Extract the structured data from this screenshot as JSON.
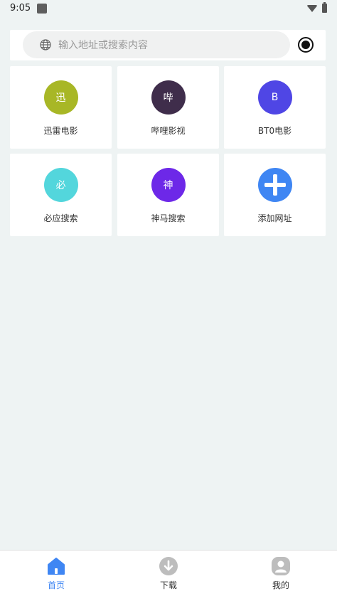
{
  "status": {
    "time": "9:05"
  },
  "search": {
    "placeholder": "输入地址或搜索内容"
  },
  "tiles": [
    {
      "glyph": "迅",
      "label": "迅雷电影",
      "color": "#a8b726"
    },
    {
      "glyph": "哔",
      "label": "哔哩影视",
      "color": "#3f2d4b"
    },
    {
      "glyph": "B",
      "label": "BT0电影",
      "color": "#4f46e5"
    },
    {
      "glyph": "必",
      "label": "必应搜索",
      "color": "#53d6dc"
    },
    {
      "glyph": "神",
      "label": "神马搜索",
      "color": "#6d28e8"
    },
    {
      "glyph": "",
      "label": "添加网址",
      "color": "#3f86f3"
    }
  ],
  "nav": {
    "home": "首页",
    "download": "下载",
    "mine": "我的",
    "active_color": "#3f86f3",
    "inactive_icon_color": "#bdbdbd"
  }
}
